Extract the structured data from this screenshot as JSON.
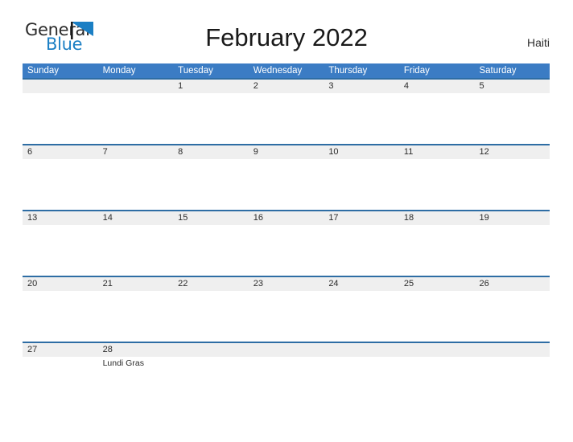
{
  "brand": {
    "name_part1": "General",
    "name_part2": "Blue",
    "flag_icon": "blue-triangle-flag",
    "color_text": "#2b2b2b",
    "color_blue": "#1b7fc4"
  },
  "header": {
    "title": "February 2022",
    "country": "Haiti"
  },
  "theme": {
    "header_blue": "#3b7cc4",
    "row_divider_blue": "#2e6da4",
    "date_band_gray": "#efefef",
    "page_background": "#ffffff"
  },
  "calendar": {
    "weekdays": [
      "Sunday",
      "Monday",
      "Tuesday",
      "Wednesday",
      "Thursday",
      "Friday",
      "Saturday"
    ],
    "weeks": [
      {
        "days": [
          {
            "date": "",
            "event": ""
          },
          {
            "date": "",
            "event": ""
          },
          {
            "date": "1",
            "event": ""
          },
          {
            "date": "2",
            "event": ""
          },
          {
            "date": "3",
            "event": ""
          },
          {
            "date": "4",
            "event": ""
          },
          {
            "date": "5",
            "event": ""
          }
        ]
      },
      {
        "days": [
          {
            "date": "6",
            "event": ""
          },
          {
            "date": "7",
            "event": ""
          },
          {
            "date": "8",
            "event": ""
          },
          {
            "date": "9",
            "event": ""
          },
          {
            "date": "10",
            "event": ""
          },
          {
            "date": "11",
            "event": ""
          },
          {
            "date": "12",
            "event": ""
          }
        ]
      },
      {
        "days": [
          {
            "date": "13",
            "event": ""
          },
          {
            "date": "14",
            "event": ""
          },
          {
            "date": "15",
            "event": ""
          },
          {
            "date": "16",
            "event": ""
          },
          {
            "date": "17",
            "event": ""
          },
          {
            "date": "18",
            "event": ""
          },
          {
            "date": "19",
            "event": ""
          }
        ]
      },
      {
        "days": [
          {
            "date": "20",
            "event": ""
          },
          {
            "date": "21",
            "event": ""
          },
          {
            "date": "22",
            "event": ""
          },
          {
            "date": "23",
            "event": ""
          },
          {
            "date": "24",
            "event": ""
          },
          {
            "date": "25",
            "event": ""
          },
          {
            "date": "26",
            "event": ""
          }
        ]
      },
      {
        "days": [
          {
            "date": "27",
            "event": ""
          },
          {
            "date": "28",
            "event": "Lundi Gras"
          },
          {
            "date": "",
            "event": ""
          },
          {
            "date": "",
            "event": ""
          },
          {
            "date": "",
            "event": ""
          },
          {
            "date": "",
            "event": ""
          },
          {
            "date": "",
            "event": ""
          }
        ]
      }
    ]
  }
}
